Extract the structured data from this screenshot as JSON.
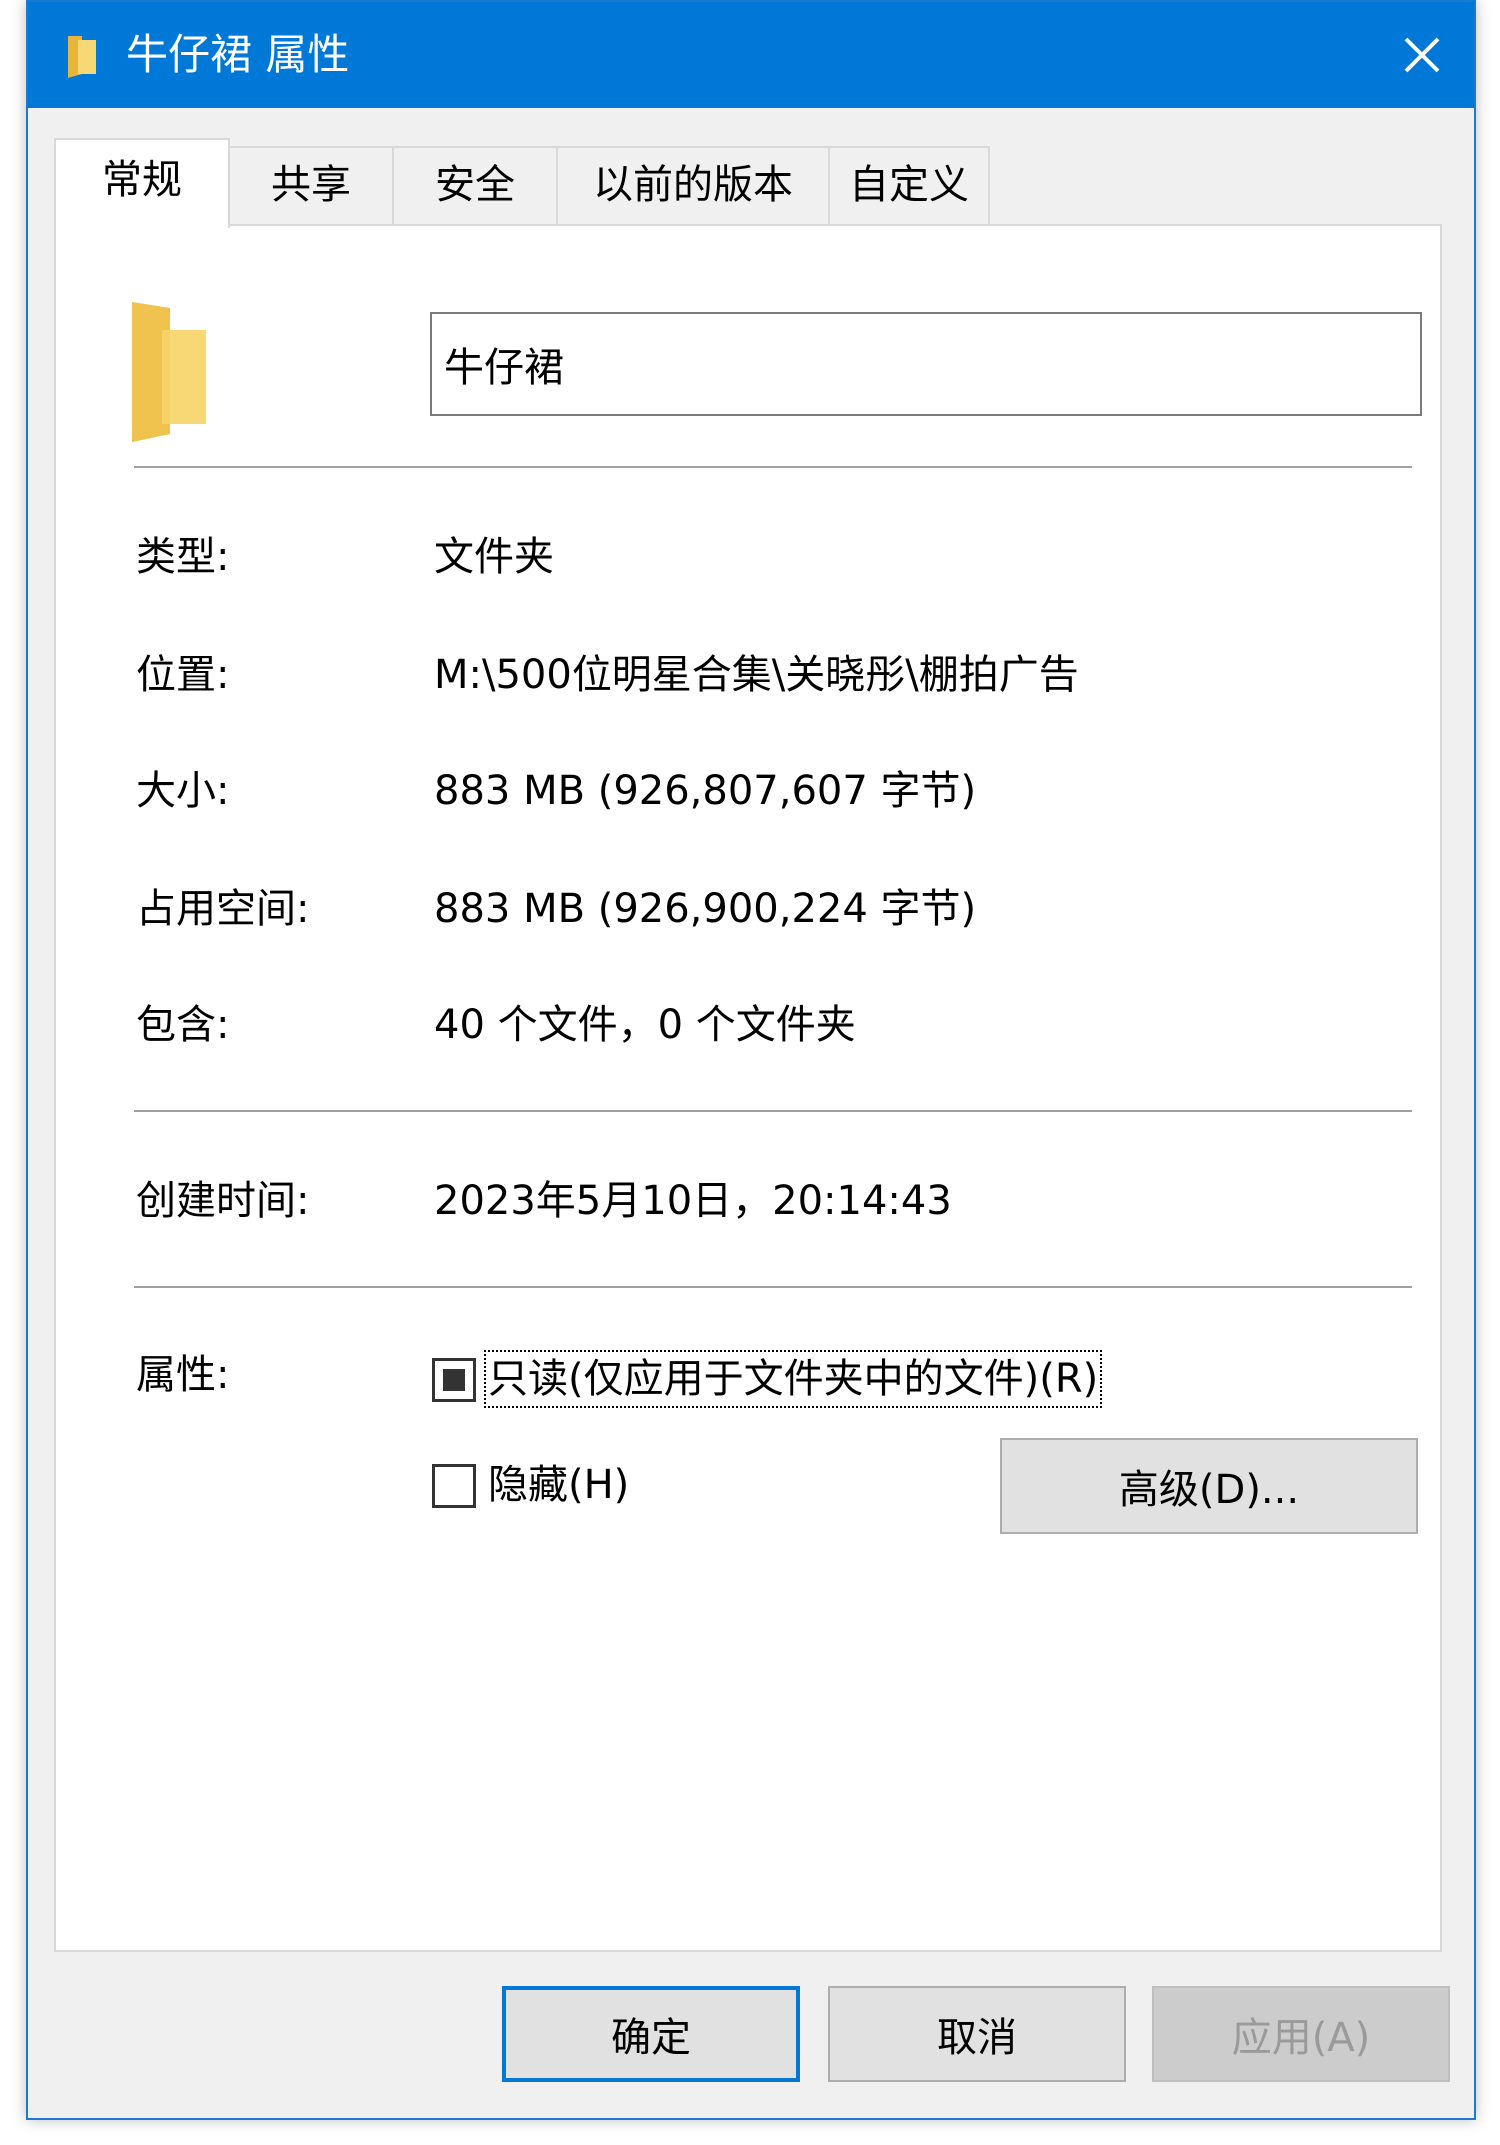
{
  "window": {
    "title": "牛仔裙 属性",
    "close_icon": "close-icon"
  },
  "tabs": [
    {
      "label": "常规",
      "active": true
    },
    {
      "label": "共享",
      "active": false
    },
    {
      "label": "安全",
      "active": false
    },
    {
      "label": "以前的版本",
      "active": false
    },
    {
      "label": "自定义",
      "active": false
    }
  ],
  "general": {
    "folder_icon": "folder-icon",
    "name_value": "牛仔裙",
    "type_label": "类型:",
    "type_value": "文件夹",
    "location_label": "位置:",
    "location_value": "M:\\500位明星合集\\关晓彤\\棚拍广告",
    "size_label": "大小:",
    "size_value": "883 MB (926,807,607 字节)",
    "size_on_disk_label": "占用空间:",
    "size_on_disk_value": "883 MB (926,900,224 字节)",
    "contains_label": "包含:",
    "contains_value": "40 个文件，0 个文件夹",
    "created_label": "创建时间:",
    "created_value": "2023年5月10日，20:14:43",
    "attributes_label": "属性:",
    "readonly_label": "只读(仅应用于文件夹中的文件)(R)",
    "readonly_state": "mixed",
    "hidden_label": "隐藏(H)",
    "hidden_state": "unchecked",
    "advanced_label": "高级(D)..."
  },
  "footer": {
    "ok_label": "确定",
    "cancel_label": "取消",
    "apply_label": "应用(A)"
  },
  "colors": {
    "titlebar": "#0078d7",
    "window_bg": "#f0f0f0",
    "panel_bg": "#ffffff",
    "folder_yellow": "#f8d775"
  }
}
